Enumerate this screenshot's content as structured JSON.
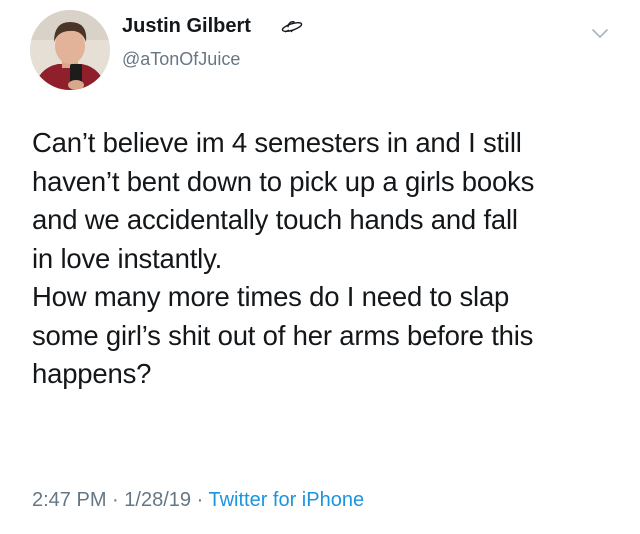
{
  "author": {
    "display_name": "Justin Gilbert",
    "handle": "@aTonOfJuice",
    "name_icon": "ufo-icon",
    "avatar": "profile-photo"
  },
  "menu": {
    "icon": "chevron-down-icon"
  },
  "tweet": {
    "lines": [
      "Can’t believe im 4 semesters in and I still",
      "haven’t bent down to pick up a girls books",
      "and we accidentally touch hands and fall",
      "in love instantly.",
      "How many more times do I need to slap",
      "some girl’s shit out of her arms before this",
      "happens?"
    ]
  },
  "meta": {
    "time": "2:47 PM",
    "date": "1/28/19",
    "separator": "·",
    "source": "Twitter for iPhone"
  },
  "colors": {
    "text": "#14171a",
    "secondary": "#657786",
    "link": "#1b95e0"
  }
}
